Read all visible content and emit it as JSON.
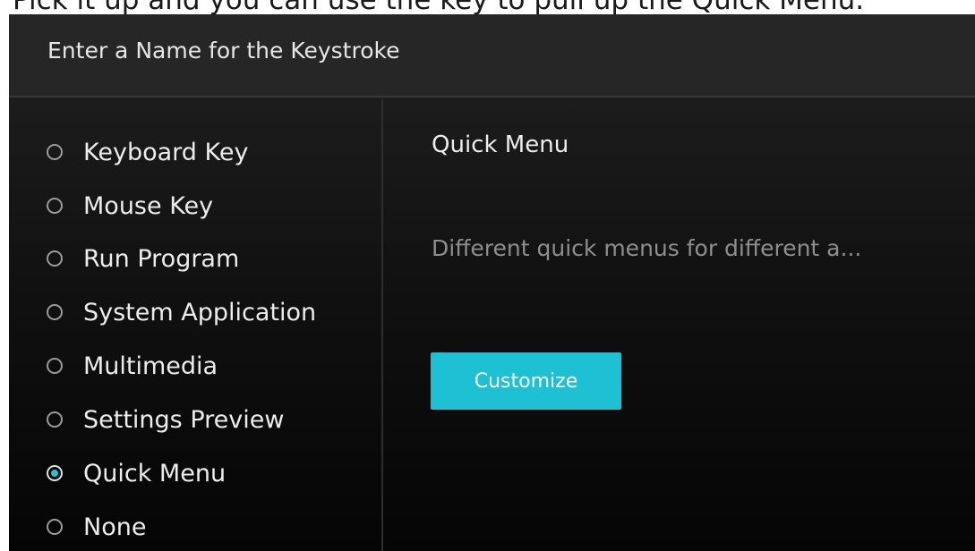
{
  "caption": "Pick it up and you can use the key to pull up the Quick Menu.",
  "dialog": {
    "title": "Enter a Name for the Keystroke"
  },
  "options": [
    {
      "label": "Keyboard Key",
      "checked": false
    },
    {
      "label": "Mouse Key",
      "checked": false
    },
    {
      "label": "Run Program",
      "checked": false
    },
    {
      "label": "System Application",
      "checked": false
    },
    {
      "label": "Multimedia",
      "checked": false
    },
    {
      "label": "Settings Preview",
      "checked": false
    },
    {
      "label": "Quick Menu",
      "checked": true
    },
    {
      "label": "None",
      "checked": false
    }
  ],
  "detail": {
    "title": "Quick Menu",
    "description": "Different quick menus for different a...",
    "button_label": "Customize"
  },
  "colors": {
    "accent": "#1ec1d4",
    "background": "#1c1c1c",
    "text": "#ececec",
    "muted_text": "#8e8e8e"
  }
}
